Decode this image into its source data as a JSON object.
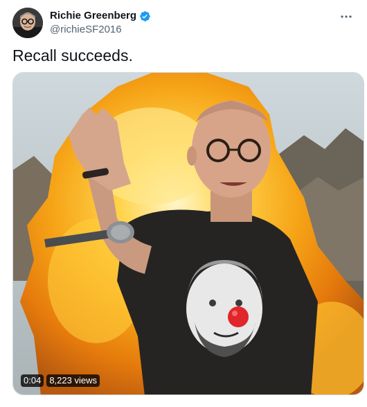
{
  "author": {
    "display_name": "Richie Greenberg",
    "handle": "@richieSF2016",
    "verified": true,
    "avatar_icon": "profile-photo"
  },
  "tweet": {
    "text": "Recall succeeds."
  },
  "media": {
    "type": "video",
    "duration": "0:04",
    "views": "8,223 views"
  },
  "icons": {
    "more": "more-horizontal-icon",
    "verified": "verified-badge-icon"
  },
  "colors": {
    "text_primary": "#0f1419",
    "text_secondary": "#536471",
    "verified_blue": "#1d9bf0",
    "border": "#cfd9de"
  }
}
